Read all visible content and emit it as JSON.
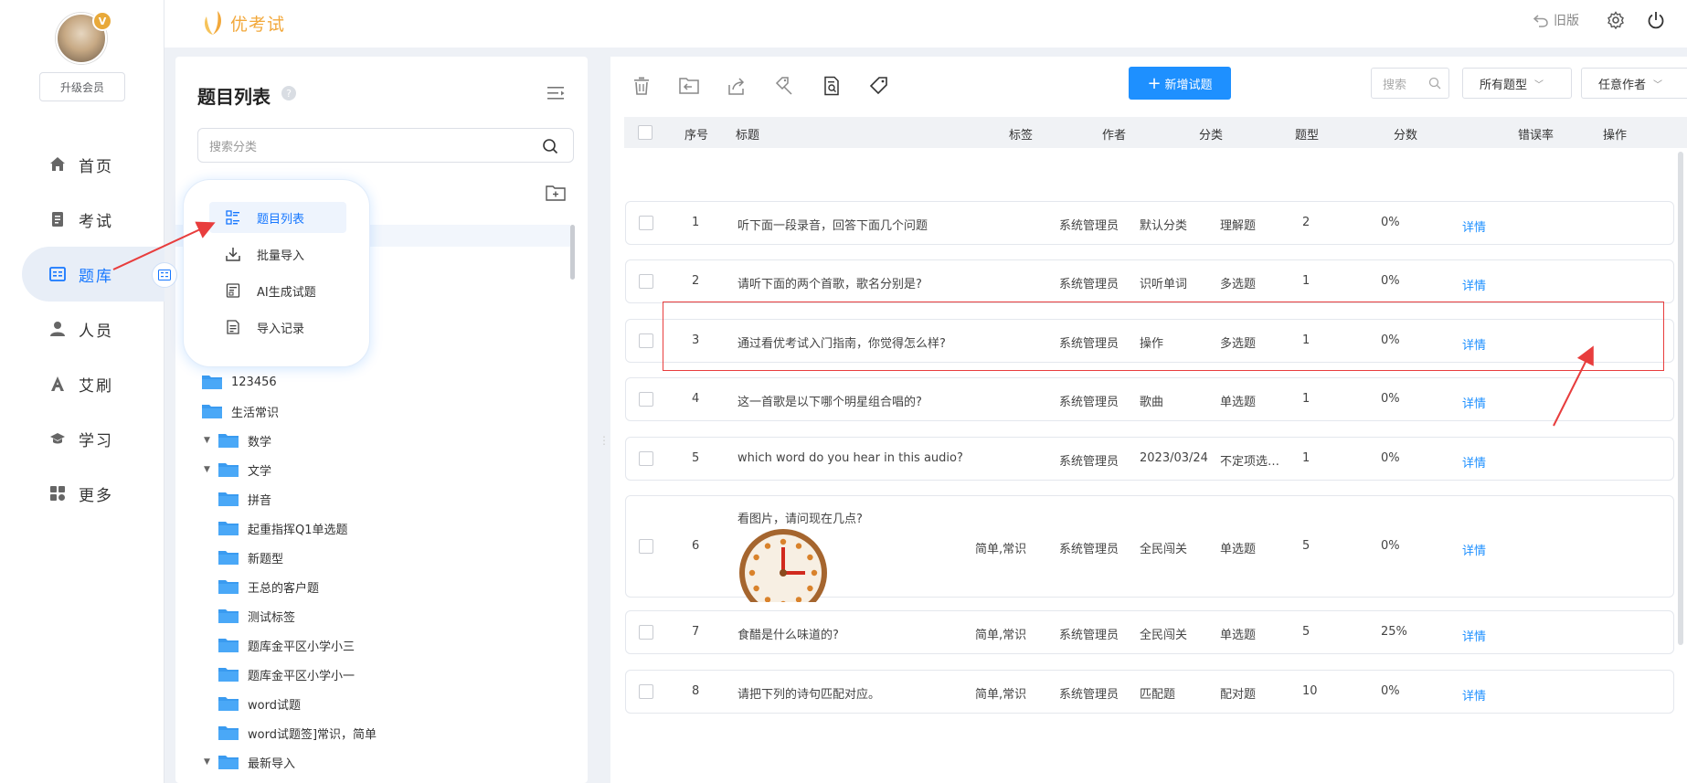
{
  "brand": {
    "name": "优考试",
    "accent": "#f2a83b"
  },
  "user": {
    "badge": "V",
    "upgrade_label": "升级会员"
  },
  "nav": [
    {
      "label": "首页",
      "icon": "home-icon"
    },
    {
      "label": "考试",
      "icon": "exam-icon"
    },
    {
      "label": "题库",
      "icon": "question-bank-icon",
      "active": true
    },
    {
      "label": "人员",
      "icon": "user-icon"
    },
    {
      "label": "艾刷",
      "icon": "ai-brush-icon"
    },
    {
      "label": "学习",
      "icon": "graduation-cap-icon"
    },
    {
      "label": "更多",
      "icon": "grid-more-icon"
    }
  ],
  "topbar": {
    "old_version_label": "旧版"
  },
  "left_panel": {
    "title": "题目列表",
    "help": "?",
    "search_placeholder": "搜索分类",
    "tree": [
      {
        "label": "123456",
        "level": 1,
        "arrow": false
      },
      {
        "label": "生活常识",
        "level": 1,
        "arrow": false
      },
      {
        "label": "数学",
        "level": 1,
        "arrow": true
      },
      {
        "label": "文学",
        "level": 1,
        "arrow": true
      },
      {
        "label": "拼音",
        "level": 2,
        "arrow": false
      },
      {
        "label": "起重指挥Q1单选题",
        "level": 2,
        "arrow": false
      },
      {
        "label": "新题型",
        "level": 2,
        "arrow": false
      },
      {
        "label": "王总的客户题",
        "level": 2,
        "arrow": false
      },
      {
        "label": "测试标签",
        "level": 2,
        "arrow": false
      },
      {
        "label": "题库金平区小学小三",
        "level": 2,
        "arrow": false
      },
      {
        "label": "题库金平区小学小一",
        "level": 2,
        "arrow": false
      },
      {
        "label": "word试题",
        "level": 2,
        "arrow": false
      },
      {
        "label": "word试题签]常识，简单",
        "level": 2,
        "arrow": false
      },
      {
        "label": "最新导入",
        "level": 1,
        "arrow": true
      }
    ]
  },
  "popup_menu": [
    {
      "label": "题目列表",
      "icon": "list-icon",
      "active": true
    },
    {
      "label": "批量导入",
      "icon": "download-icon"
    },
    {
      "label": "AI生成试题",
      "icon": "ai-document-icon"
    },
    {
      "label": "导入记录",
      "icon": "record-icon"
    }
  ],
  "toolbar": {
    "add_label": "新增试题",
    "search_placeholder": "搜索",
    "type_select": "所有题型",
    "author_select": "任意作者"
  },
  "table": {
    "headers": [
      "序号",
      "标题",
      "标签",
      "作者",
      "分类",
      "题型",
      "分数",
      "错误率",
      "操作"
    ],
    "rows": [
      {
        "no": "1",
        "title": "听下面一段录音，回答下面几个问题",
        "tags": "",
        "author": "系统管理员",
        "category": "默认分类",
        "type": "理解题",
        "score": "2",
        "error": "0%",
        "action": "详情"
      },
      {
        "no": "2",
        "title": "请听下面的两个首歌，歌名分别是?",
        "tags": "",
        "author": "系统管理员",
        "category": "识听单词",
        "type": "多选题",
        "score": "1",
        "error": "0%",
        "action": "详情"
      },
      {
        "no": "3",
        "title": "通过看优考试入门指南，你觉得怎么样?",
        "tags": "",
        "author": "系统管理员",
        "category": "操作",
        "type": "多选题",
        "score": "1",
        "error": "0%",
        "action": "详情"
      },
      {
        "no": "4",
        "title": "这一首歌是以下哪个明星组合唱的?",
        "tags": "",
        "author": "系统管理员",
        "category": "歌曲",
        "type": "单选题",
        "score": "1",
        "error": "0%",
        "action": "详情"
      },
      {
        "no": "5",
        "title": "which word do you hear in this audio?",
        "tags": "",
        "author": "系统管理员",
        "category": "2023/03/24",
        "type": "不定项选…",
        "score": "1",
        "error": "0%",
        "action": "详情"
      },
      {
        "no": "6",
        "title": "看图片，请问现在几点?",
        "tags": "简单,常识",
        "author": "系统管理员",
        "category": "全民闯关",
        "type": "单选题",
        "score": "5",
        "error": "0%",
        "action": "详情"
      },
      {
        "no": "7",
        "title": "食醋是什么味道的?",
        "tags": "简单,常识",
        "author": "系统管理员",
        "category": "全民闯关",
        "type": "单选题",
        "score": "5",
        "error": "25%",
        "action": "详情"
      },
      {
        "no": "8",
        "title": "请把下列的诗句匹配对应。",
        "tags": "简单,常识",
        "author": "系统管理员",
        "category": "匹配题",
        "type": "配对题",
        "score": "10",
        "error": "0%",
        "action": "详情"
      }
    ]
  },
  "colors": {
    "primary": "#1e90ff",
    "annotation": "#e83d3d"
  }
}
